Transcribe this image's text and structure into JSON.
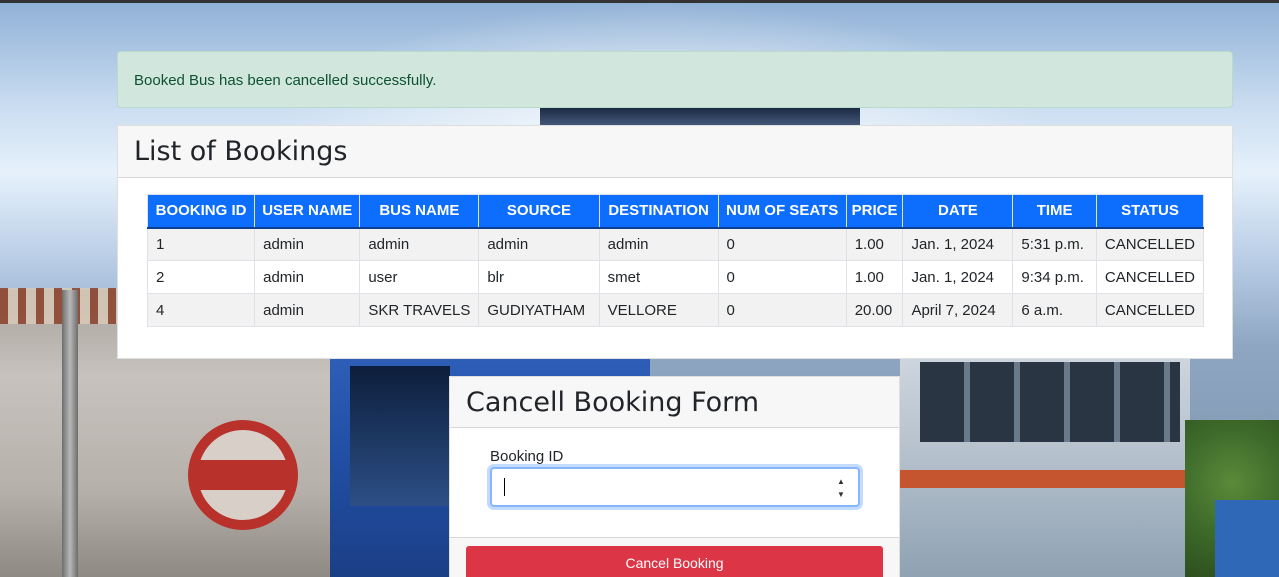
{
  "alert": {
    "message": "Booked Bus has been cancelled successfully."
  },
  "bookings": {
    "title": "List of Bookings",
    "columns": [
      "BOOKING ID",
      "USER NAME",
      "BUS NAME",
      "SOURCE",
      "DESTINATION",
      "NUM OF SEATS",
      "PRICE",
      "DATE",
      "TIME",
      "STATUS"
    ],
    "rows": [
      [
        "1",
        "admin",
        "admin",
        "admin",
        "admin",
        "0",
        "1.00",
        "Jan. 1, 2024",
        "5:31 p.m.",
        "CANCELLED"
      ],
      [
        "2",
        "admin",
        "user",
        "blr",
        "smet",
        "0",
        "1.00",
        "Jan. 1, 2024",
        "9:34 p.m.",
        "CANCELLED"
      ],
      [
        "4",
        "admin",
        "SKR TRAVELS",
        "GUDIYATHAM",
        "VELLORE",
        "0",
        "20.00",
        "April 7, 2024",
        "6 a.m.",
        "CANCELLED"
      ]
    ]
  },
  "cancel_form": {
    "title": "Cancell Booking Form",
    "booking_id_label": "Booking ID",
    "booking_id_value": "",
    "submit_label": "Cancel Booking"
  },
  "colors": {
    "header_blue": "#0d6efd",
    "danger_red": "#dc3545",
    "alert_green_bg": "#d1e7dd",
    "alert_green_text": "#0f5132"
  },
  "icons": {
    "spinner_up": "spinner-up-icon",
    "spinner_down": "spinner-down-icon"
  }
}
